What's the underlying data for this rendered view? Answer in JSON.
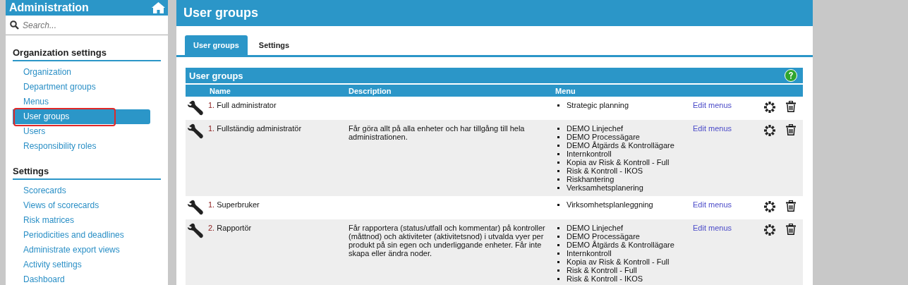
{
  "sidebar": {
    "title": "Administration",
    "search": {
      "placeholder": "Search..."
    },
    "sections": [
      {
        "heading": "Organization settings",
        "items": [
          {
            "label": "Organization",
            "selected": false,
            "highlighted": false
          },
          {
            "label": "Department groups",
            "selected": false,
            "highlighted": false
          },
          {
            "label": "Menus",
            "selected": false,
            "highlighted": false
          },
          {
            "label": "User groups",
            "selected": true,
            "highlighted": true
          },
          {
            "label": "Users",
            "selected": false,
            "highlighted": false
          },
          {
            "label": "Responsibility roles",
            "selected": false,
            "highlighted": false
          }
        ]
      },
      {
        "heading": "Settings",
        "items": [
          {
            "label": "Scorecards",
            "selected": false,
            "highlighted": false
          },
          {
            "label": "Views of scorecards",
            "selected": false,
            "highlighted": false
          },
          {
            "label": "Risk matrices",
            "selected": false,
            "highlighted": false
          },
          {
            "label": "Periodicities and deadlines",
            "selected": false,
            "highlighted": false
          },
          {
            "label": "Administrate export views",
            "selected": false,
            "highlighted": false
          },
          {
            "label": "Activity settings",
            "selected": false,
            "highlighted": false
          },
          {
            "label": "Dashboard",
            "selected": false,
            "highlighted": false
          }
        ]
      }
    ]
  },
  "page": {
    "title": "User groups",
    "tabs": [
      {
        "label": "User groups",
        "selected": true
      },
      {
        "label": "Settings",
        "selected": false
      }
    ],
    "panel": {
      "title": "User groups",
      "columns": [
        "Name",
        "Description",
        "Menu"
      ],
      "rows": [
        {
          "number": "1.",
          "name": "Full administrator",
          "description": "",
          "menus": [
            "Strategic planning"
          ],
          "action": "Edit menus"
        },
        {
          "number": "1.",
          "name": "Fullständig administratör",
          "description": "Får göra allt på alla enheter och har tillgång till hela administrationen.",
          "menus": [
            "DEMO Linjechef",
            "DEMO Processägare",
            "DEMO Åtgärds & Kontrollägare",
            "Internkontroll",
            "Kopia av Risk & Kontroll - Full",
            "Risk & Kontroll - IKOS",
            "Riskhantering",
            "Verksamhetsplanering"
          ],
          "action": "Edit menus"
        },
        {
          "number": "1.",
          "name": "Superbruker",
          "description": "",
          "menus": [
            "Virksomhetsplanleggning"
          ],
          "action": "Edit menus"
        },
        {
          "number": "2.",
          "name": "Rapportör",
          "description": "Får rapportera (status/utfall och kommentar) på kontroller (måttnod) och aktiviteter (aktivitetsnod) i utvalda vyer per produkt på sin egen och underliggande enheter. Får inte skapa eller ändra noder.",
          "menus": [
            "DEMO Linjechef",
            "DEMO Processägare",
            "DEMO Åtgärds & Kontrollägare",
            "Internkontroll",
            "Kopia av Risk & Kontroll - Full",
            "Risk & Kontroll - Full",
            "Risk & Kontroll - IKOS"
          ],
          "action": "Edit menus"
        }
      ]
    }
  }
}
